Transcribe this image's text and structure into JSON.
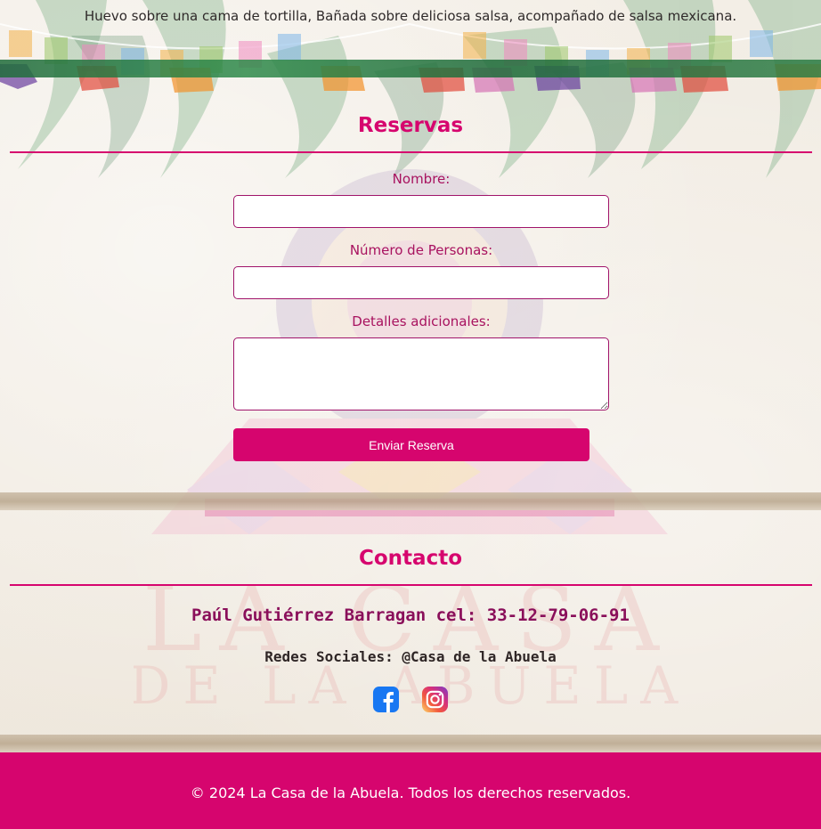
{
  "menu_item": {
    "description": "Huevo sobre una cama de tortilla, Bañada sobre deliciosa salsa, acompañado de salsa mexicana."
  },
  "reservas": {
    "title": "Reservas",
    "fields": {
      "nombre_label": "Nombre:",
      "nombre_value": "",
      "personas_label": "Número de Personas:",
      "personas_value": "",
      "detalles_label": "Detalles adicionales:",
      "detalles_value": ""
    },
    "submit_label": "Enviar Reserva"
  },
  "contacto": {
    "title": "Contacto",
    "name_phone": "Paúl Gutiérrez Barragan cel: 33-12-79-06-91",
    "social": "Redes Sociales: @Casa de la Abuela",
    "social_icons": [
      "facebook-icon",
      "instagram-icon"
    ]
  },
  "watermark": {
    "line1": "LA CASA",
    "line2": "DE LA ABUELA"
  },
  "footer": {
    "text": "© 2024 La Casa de la Abuela. Todos los derechos reservados."
  },
  "colors": {
    "accent": "#d6056e",
    "label": "#a8125f",
    "contact": "#8a0f5a",
    "footer_bg": "#d6056e",
    "facebook": "#1877f2"
  }
}
